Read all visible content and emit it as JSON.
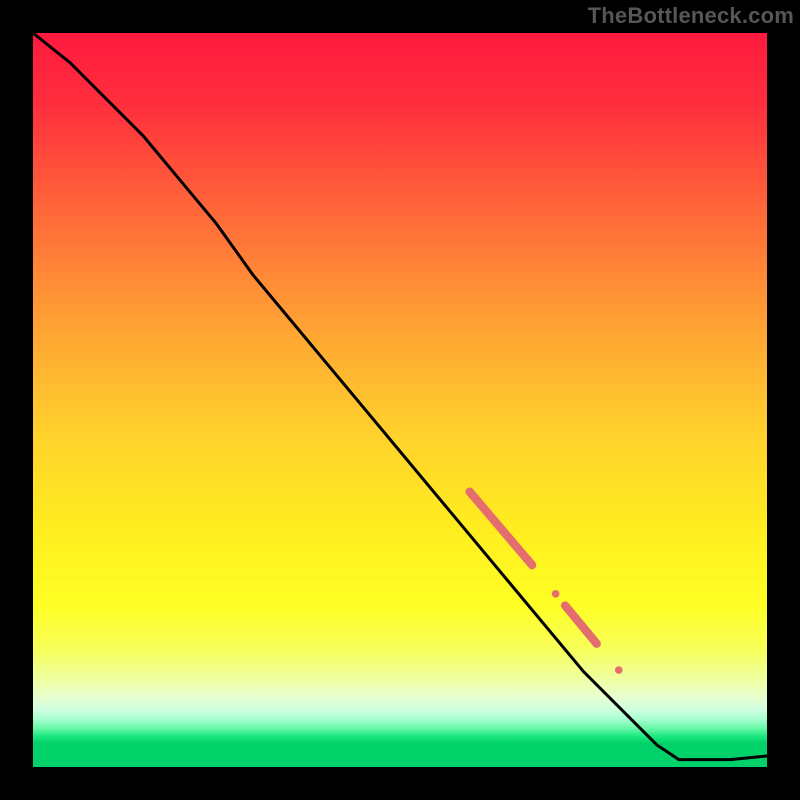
{
  "watermark": "TheBottleneck.com",
  "colors": {
    "frame": "#000000",
    "line": "#000000",
    "marker": "#e46e6d",
    "gradient_stops": [
      {
        "offset": 0.0,
        "color": "#ff1a3f"
      },
      {
        "offset": 0.1,
        "color": "#ff2f3d"
      },
      {
        "offset": 0.25,
        "color": "#ff6a39"
      },
      {
        "offset": 0.4,
        "color": "#ffa334"
      },
      {
        "offset": 0.55,
        "color": "#ffd22c"
      },
      {
        "offset": 0.68,
        "color": "#ffee1f"
      },
      {
        "offset": 0.78,
        "color": "#feff24"
      },
      {
        "offset": 0.84,
        "color": "#f7ff5a"
      },
      {
        "offset": 0.88,
        "color": "#efffa0"
      },
      {
        "offset": 0.905,
        "color": "#e7ffd0"
      },
      {
        "offset": 0.922,
        "color": "#cfffe0"
      },
      {
        "offset": 0.935,
        "color": "#a6ffce"
      },
      {
        "offset": 0.948,
        "color": "#63f8a6"
      },
      {
        "offset": 0.958,
        "color": "#1ee880"
      },
      {
        "offset": 0.968,
        "color": "#00d269"
      },
      {
        "offset": 1.0,
        "color": "#00d269"
      }
    ]
  },
  "chart_data": {
    "type": "line",
    "title": "",
    "xlabel": "",
    "ylabel": "",
    "xlim": [
      0,
      100
    ],
    "ylim": [
      0,
      100
    ],
    "series": [
      {
        "name": "main-curve",
        "x": [
          0,
          5,
          10,
          15,
          20,
          25,
          30,
          35,
          40,
          45,
          50,
          55,
          60,
          65,
          70,
          75,
          80,
          85,
          88,
          90,
          95,
          100
        ],
        "y": [
          100,
          96,
          91,
          86,
          80,
          74,
          67,
          61,
          55,
          49,
          43,
          37,
          31,
          25,
          19,
          13,
          8,
          3,
          1,
          1,
          1,
          1.5
        ]
      }
    ],
    "markers": [
      {
        "shape": "capsule",
        "x1": 59.5,
        "y1": 37.5,
        "x2": 68.0,
        "y2": 27.5,
        "r": 4.2
      },
      {
        "shape": "dot",
        "x": 71.2,
        "y": 23.6,
        "r": 3.8
      },
      {
        "shape": "capsule",
        "x1": 72.5,
        "y1": 22.0,
        "x2": 76.8,
        "y2": 16.8,
        "r": 4.2
      },
      {
        "shape": "dot",
        "x": 79.8,
        "y": 13.2,
        "r": 3.8
      }
    ],
    "annotations": []
  }
}
